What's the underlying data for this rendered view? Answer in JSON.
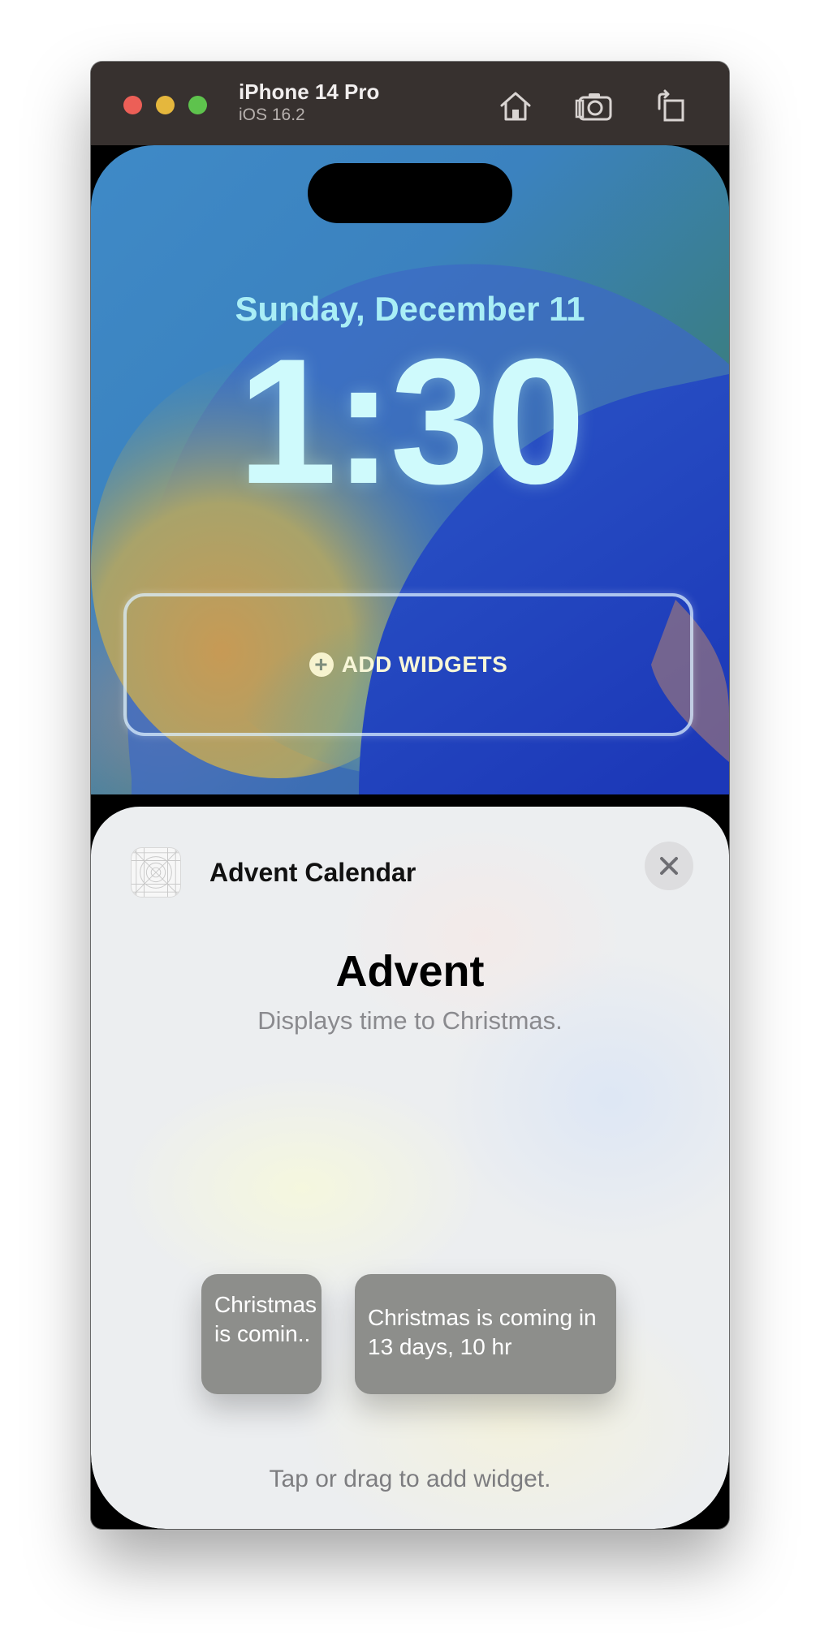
{
  "window": {
    "device_name": "iPhone 14 Pro",
    "os_version": "iOS 16.2",
    "toolbar_icons": [
      "home-icon",
      "screenshot-icon",
      "rotate-icon"
    ]
  },
  "lock_screen": {
    "date": "Sunday, December 11",
    "time": "1:30",
    "add_widgets_label": "ADD WIDGETS"
  },
  "sheet": {
    "app_name": "Advent Calendar",
    "widget_title": "Advent",
    "widget_description": "Displays time to Christmas.",
    "previews": [
      {
        "kind": "circular",
        "text": "Christmas is comin.."
      },
      {
        "kind": "rectangular",
        "text": "Christmas is coming in 13 days, 10 hr"
      }
    ],
    "hint": "Tap or drag to add widget."
  },
  "colors": {
    "titlebar": "#37312f",
    "traffic_close": "#ec5f57",
    "traffic_minimize": "#e5b73d",
    "traffic_maximize": "#5ec34d",
    "date_text": "#a9eef6",
    "preview_bg": "#8d8e8b"
  }
}
